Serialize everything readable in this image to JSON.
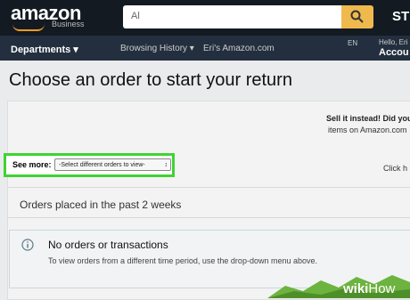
{
  "header": {
    "logo": "amazon",
    "logo_sub": "Business",
    "search_value": "Al",
    "right_text": "ST"
  },
  "nav": {
    "departments": "Departments ▾",
    "browsing_history": "Browsing History ▾",
    "amazon_com": "Eri's Amazon.com",
    "lang": "EN",
    "hello": "Hello, Eri",
    "account": "Accou"
  },
  "page": {
    "title": "Choose an order to start your return"
  },
  "sell": {
    "title": "Sell it instead! Did you",
    "text": "items on Amazon.com"
  },
  "filter": {
    "label": "See more:",
    "select_value": "-Select different orders to view-",
    "select_arrow": "↕",
    "click_here": "Click h"
  },
  "orders": {
    "period": "Orders placed in the past 2 weeks"
  },
  "alert": {
    "title": "No orders or transactions",
    "text": "To view orders from a different time period, use the drop-down menu above."
  },
  "watermark": {
    "wiki": "wiki",
    "how": "How"
  },
  "colors": {
    "header_bg": "#131a22",
    "nav_bg": "#232f3e",
    "search_button": "#f0b94d",
    "highlight": "#3fd334",
    "logo_smile": "#f39b1f"
  }
}
